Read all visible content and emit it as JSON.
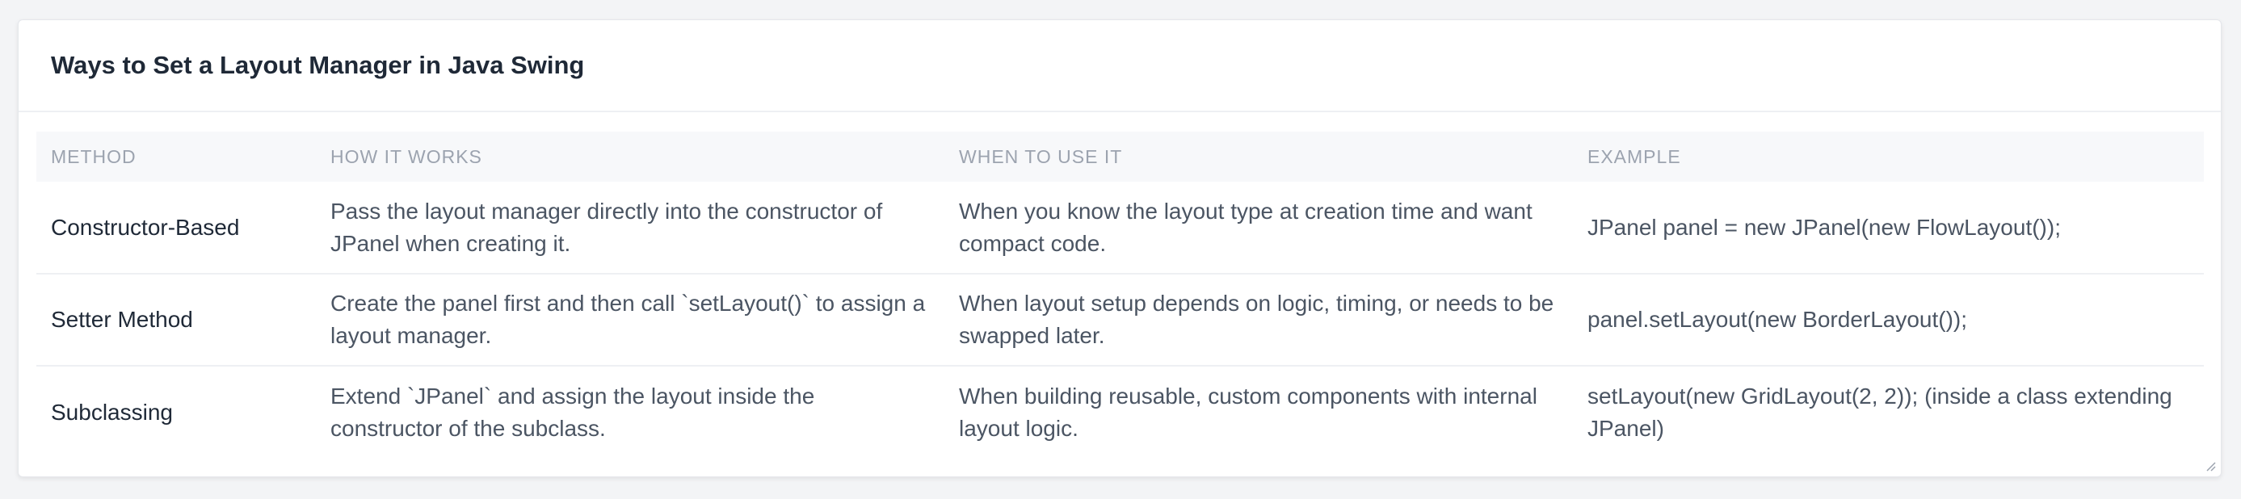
{
  "card": {
    "title": "Ways to Set a Layout Manager in Java Swing"
  },
  "table": {
    "headers": [
      "METHOD",
      "HOW IT WORKS",
      "WHEN TO USE IT",
      "EXAMPLE"
    ],
    "rows": [
      {
        "method": "Constructor-Based",
        "how": "Pass the layout manager directly into the constructor of JPanel when creating it.",
        "when": "When you know the layout type at creation time and want compact code.",
        "example": "JPanel panel = new JPanel(new FlowLayout());"
      },
      {
        "method": "Setter Method",
        "how": "Create the panel first and then call `setLayout()` to assign a layout manager.",
        "when": "When layout setup depends on logic, timing, or needs to be swapped later.",
        "example": "panel.setLayout(new BorderLayout());"
      },
      {
        "method": "Subclassing",
        "how": "Extend `JPanel` and assign the layout inside the constructor of the subclass.",
        "when": "When building reusable, custom components with internal layout logic.",
        "example": "setLayout(new GridLayout(2, 2)); (inside a class extending JPanel)"
      }
    ]
  },
  "icons": {
    "resize": "resize-grip-icon"
  }
}
